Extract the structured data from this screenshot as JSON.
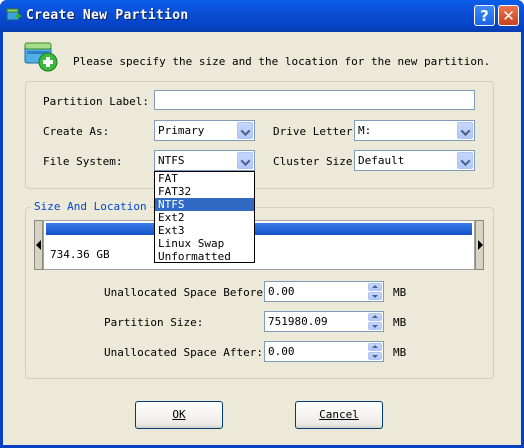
{
  "window": {
    "title": "Create New Partition",
    "help_label": "?",
    "close_label": "✕"
  },
  "header": {
    "text": "Please specify the size and the location for the new partition.",
    "icon": "add-partition-icon"
  },
  "form": {
    "partition_label": {
      "label": "Partition Label:",
      "value": ""
    },
    "create_as": {
      "label": "Create As:",
      "value": "Primary"
    },
    "drive_letter": {
      "label": "Drive Letter:",
      "value": "M:"
    },
    "file_system": {
      "label": "File System:",
      "value": "NTFS"
    },
    "cluster_size": {
      "label": "Cluster Size:",
      "value": "Default"
    }
  },
  "file_system_options": [
    "FAT",
    "FAT32",
    "NTFS",
    "Ext2",
    "Ext3",
    "Linux Swap",
    "Unformatted"
  ],
  "size_location": {
    "title": "Size And Location",
    "disk_size": "734.36 GB",
    "before": {
      "label": "Unallocated Space Before:",
      "value": "0.00",
      "unit": "MB"
    },
    "size": {
      "label": "Partition Size:",
      "value": "751980.09",
      "unit": "MB"
    },
    "after": {
      "label": "Unallocated Space After:",
      "value": "0.00",
      "unit": "MB"
    }
  },
  "buttons": {
    "ok": "OK",
    "cancel": "Cancel"
  },
  "colors": {
    "titlebar": "#0b4ed6",
    "selection": "#316ac5",
    "partition_bar": "#1152c9"
  }
}
